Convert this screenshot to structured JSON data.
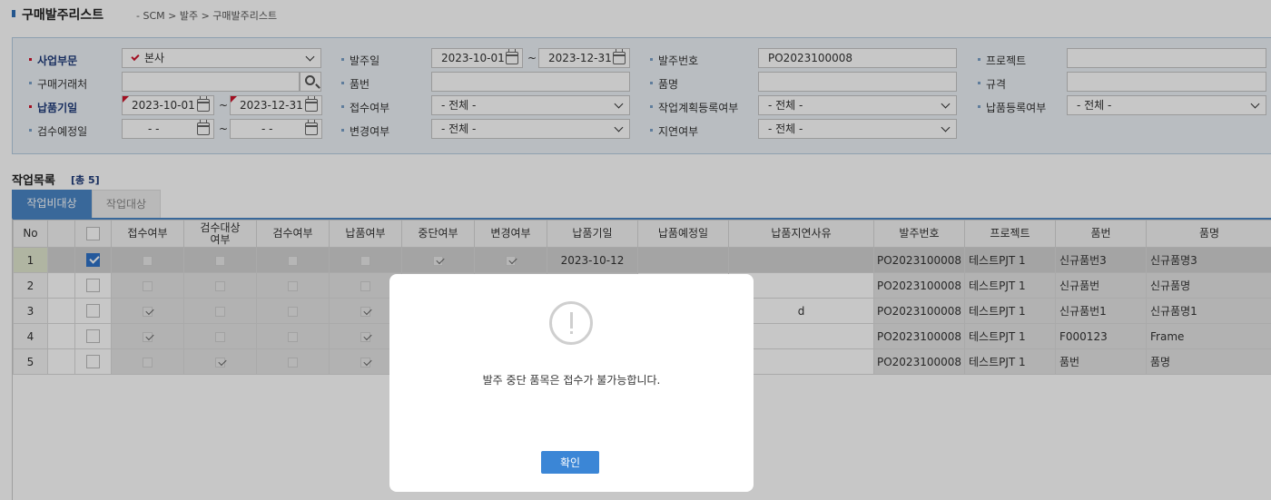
{
  "header": {
    "title": "구매발주리스트",
    "breadcrumb": "- SCM > 발주 > 구매발주리스트"
  },
  "search": {
    "business_unit": {
      "label": "사업부문",
      "value": "본사"
    },
    "vendor": {
      "label": "구매거래처",
      "value": ""
    },
    "delivery_date": {
      "label": "납품기일",
      "from": "2023-10-01",
      "to": "2023-12-31"
    },
    "inspection_date": {
      "label": "검수예정일",
      "from": "-  -",
      "to": "-  -"
    },
    "order_date": {
      "label": "발주일",
      "from": "2023-10-01",
      "to": "2023-12-31"
    },
    "item_code": {
      "label": "품번",
      "value": ""
    },
    "receipt_status": {
      "label": "접수여부",
      "value": "- 전체 -"
    },
    "change_status": {
      "label": "변경여부",
      "value": "- 전체 -"
    },
    "order_no": {
      "label": "발주번호",
      "value": "PO2023100008"
    },
    "item_name": {
      "label": "품명",
      "value": ""
    },
    "work_plan_status": {
      "label": "작업계획등록여부",
      "value": "- 전체 -"
    },
    "delay_status": {
      "label": "지연여부",
      "value": "- 전체 -"
    },
    "project": {
      "label": "프로젝트",
      "value": ""
    },
    "spec": {
      "label": "규격",
      "value": ""
    },
    "delivery_reg_status": {
      "label": "납품등록여부",
      "value": "- 전체 -"
    },
    "tilde": "~"
  },
  "worklist": {
    "title": "작업목록",
    "count": "[총 5]",
    "tabs": [
      "작업비대상",
      "작업대상"
    ]
  },
  "grid": {
    "columns": [
      "No",
      "",
      "",
      "접수여부",
      "검수대상\n여부",
      "검수여부",
      "납품여부",
      "중단여부",
      "변경여부",
      "납품기일",
      "납품예정일",
      "납품지연사유",
      "발주번호",
      "프로젝트",
      "품번",
      "품명"
    ],
    "rows": [
      {
        "no": "1",
        "selected": true,
        "received": false,
        "insp_target": false,
        "inspected": false,
        "delivered": false,
        "stopped": true,
        "changed": true,
        "due": "2023-10-12",
        "planned": "",
        "delay_reason": "",
        "order_no": "PO2023100008",
        "project": "테스트PJT 1",
        "item_code": "신규품번3",
        "item_name": "신규품명3"
      },
      {
        "no": "2",
        "selected": false,
        "received": false,
        "insp_target": false,
        "inspected": false,
        "delivered": false,
        "stopped": false,
        "changed": false,
        "due": "",
        "planned": "",
        "delay_reason": "",
        "order_no": "PO2023100008",
        "project": "테스트PJT 1",
        "item_code": "신규품번",
        "item_name": "신규품명"
      },
      {
        "no": "3",
        "selected": false,
        "received": true,
        "insp_target": false,
        "inspected": false,
        "delivered": true,
        "stopped": false,
        "changed": false,
        "due": "",
        "planned": "",
        "delay_reason": "d",
        "order_no": "PO2023100008",
        "project": "테스트PJT 1",
        "item_code": "신규품번1",
        "item_name": "신규품명1"
      },
      {
        "no": "4",
        "selected": false,
        "received": true,
        "insp_target": false,
        "inspected": false,
        "delivered": true,
        "stopped": false,
        "changed": false,
        "due": "",
        "planned": "",
        "delay_reason": "",
        "order_no": "PO2023100008",
        "project": "테스트PJT 1",
        "item_code": "F000123",
        "item_name": "Frame"
      },
      {
        "no": "5",
        "selected": false,
        "received": false,
        "insp_target": true,
        "inspected": false,
        "delivered": true,
        "stopped": false,
        "changed": false,
        "due": "",
        "planned": "",
        "delay_reason": "",
        "order_no": "PO2023100008",
        "project": "테스트PJT 1",
        "item_code": "품번",
        "item_name": "품명"
      }
    ]
  },
  "modal": {
    "icon": "exclamation-circle-icon",
    "message": "발주 중단 품목은 접수가 불가능합니다.",
    "ok_label": "확인"
  }
}
